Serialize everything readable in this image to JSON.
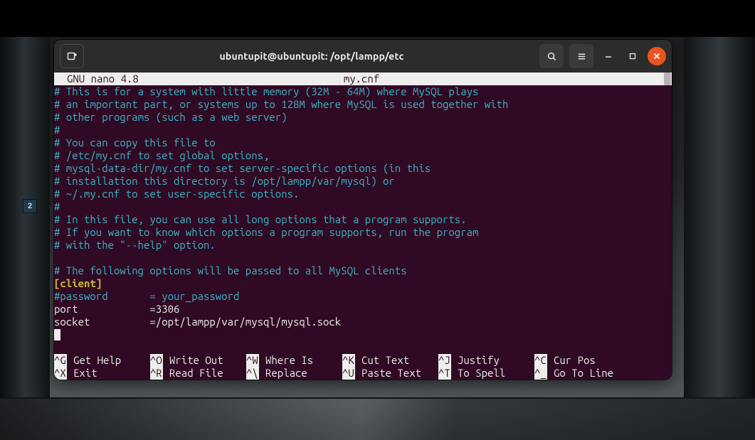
{
  "window": {
    "title": "ubuntupit@ubuntupit: /opt/lampp/etc"
  },
  "nano": {
    "app": "GNU nano 4.8",
    "filename": "my.cnf"
  },
  "lines": {
    "l01": "# This is for a system with little memory (32M - 64M) where MySQL plays",
    "l02": "# an important part, or systems up to 128M where MySQL is used together with",
    "l03": "# other programs (such as a web server)",
    "l04": "#",
    "l05": "# You can copy this file to",
    "l06": "# /etc/my.cnf to set global options,",
    "l07": "# mysql-data-dir/my.cnf to set server-specific options (in this",
    "l08": "# installation this directory is /opt/lampp/var/mysql) or",
    "l09": "# ~/.my.cnf to set user-specific options.",
    "l10": "#",
    "l11": "# In this file, you can use all long options that a program supports.",
    "l12": "# If you want to know which options a program supports, run the program",
    "l13": "# with the \"--help\" option.",
    "l14": "",
    "l15": "# The following options will be passed to all MySQL clients",
    "l16": "[client]",
    "l17": "#password       = your_password",
    "l18": "port            =3306",
    "l19": "socket          =/opt/lampp/var/mysql/mysql.sock"
  },
  "shortcuts": {
    "row1": [
      {
        "key": "^G",
        "label": "Get Help"
      },
      {
        "key": "^O",
        "label": "Write Out"
      },
      {
        "key": "^W",
        "label": "Where Is"
      },
      {
        "key": "^K",
        "label": "Cut Text"
      },
      {
        "key": "^J",
        "label": "Justify"
      },
      {
        "key": "^C",
        "label": "Cur Pos"
      }
    ],
    "row2": [
      {
        "key": "^X",
        "label": "Exit"
      },
      {
        "key": "^R",
        "label": "Read File"
      },
      {
        "key": "^\\",
        "label": "Replace"
      },
      {
        "key": "^U",
        "label": "Paste Text"
      },
      {
        "key": "^T",
        "label": "To Spell"
      },
      {
        "key": "^_",
        "label": "Go To Line"
      }
    ]
  },
  "wallpaper_sign": "2"
}
